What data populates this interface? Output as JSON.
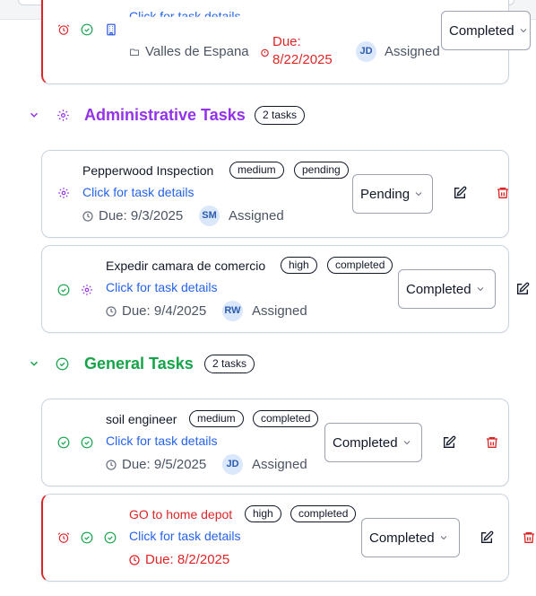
{
  "colors": {
    "overdue": "#dc2626",
    "link": "#2563eb",
    "admin_section": "#9333ea",
    "general_section": "#16a34a"
  },
  "top_task": {
    "link": "Click for task details",
    "location": "Valles de Espana",
    "due": "Due: 8/22/2025",
    "assignee_initials": "JD",
    "assigned_label": "Assigned",
    "status": "Completed",
    "icons": [
      "alarm-icon",
      "check-circle-icon",
      "building-icon",
      "folder-icon"
    ]
  },
  "sections": [
    {
      "title": "Administrative Tasks",
      "count": "2 tasks",
      "icon": "gear-icon",
      "tasks": [
        {
          "title": "Pepperwood Inspection",
          "priority": "medium",
          "state": "pending",
          "link": "Click for task details",
          "due": "Due: 9/3/2025",
          "assignee_initials": "SM",
          "assigned_label": "Assigned",
          "status": "Pending"
        },
        {
          "title": "Expedir camara de comercio",
          "priority": "high",
          "state": "completed",
          "link": "Click for task details",
          "due": "Due: 9/4/2025",
          "assignee_initials": "RW",
          "assigned_label": "Assigned",
          "status": "Completed"
        }
      ]
    },
    {
      "title": "General Tasks",
      "count": "2 tasks",
      "icon": "check-circle-icon",
      "tasks": [
        {
          "title": "soil engineer",
          "priority": "medium",
          "state": "completed",
          "link": "Click for task details",
          "due": "Due: 9/5/2025",
          "assignee_initials": "JD",
          "assigned_label": "Assigned",
          "status": "Completed"
        },
        {
          "title": "GO to home depot",
          "priority": "high",
          "state": "completed",
          "link": "Click for task details",
          "due": "Due: 8/2/2025",
          "status": "Completed"
        }
      ]
    }
  ]
}
